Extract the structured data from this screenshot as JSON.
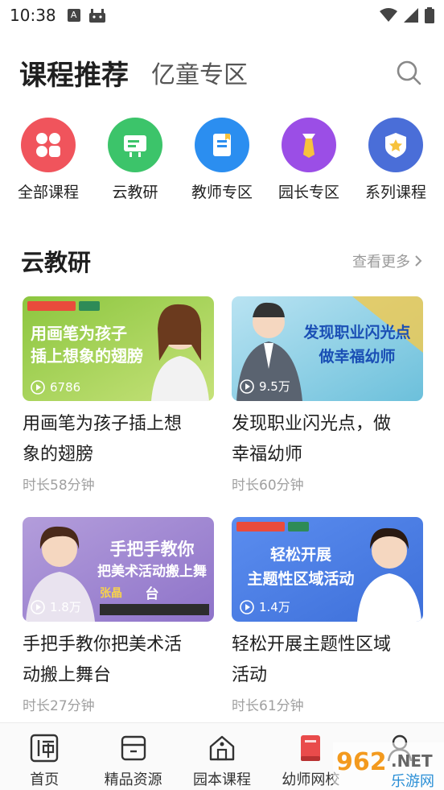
{
  "status_bar": {
    "time": "10:38",
    "left_icons": [
      "a-icon",
      "android-icon"
    ],
    "right_icons": [
      "wifi-icon",
      "signal-icon",
      "battery-icon"
    ]
  },
  "header": {
    "active_tab": "课程推荐",
    "inactive_tab": "亿童专区",
    "search_icon": "search-icon"
  },
  "categories": [
    {
      "label": "全部课程",
      "icon": "grid-icon",
      "color": "#f0545c"
    },
    {
      "label": "云教研",
      "icon": "board-icon",
      "color": "#3cc46a"
    },
    {
      "label": "教师专区",
      "icon": "document-icon",
      "color": "#2b8ef0"
    },
    {
      "label": "园长专区",
      "icon": "tie-icon",
      "color": "#9b4ee6"
    },
    {
      "label": "系列课程",
      "icon": "star-shield-icon",
      "color": "#4a6ed8"
    }
  ],
  "section": {
    "title": "云教研",
    "more": "查看更多"
  },
  "cards": [
    {
      "title_line1": "用画笔为孩子插上想",
      "title_line2": "象的翅膀",
      "duration": "时长58分钟",
      "views": "6786",
      "thumb_text1": "用画笔为孩子",
      "thumb_text2": "插上想象的翅膀"
    },
    {
      "title_line1": "发现职业闪光点，做",
      "title_line2": "幸福幼师",
      "duration": "时长60分钟",
      "views": "9.5万",
      "thumb_text1": "发现职业闪光点",
      "thumb_text2": "做幸福幼师"
    },
    {
      "title_line1": "手把手教你把美术活",
      "title_line2": "动搬上舞台",
      "duration": "时长27分钟",
      "views": "1.8万",
      "thumb_text1": "手把手教你",
      "thumb_text2": "把美术活动搬上舞台",
      "thumb_name": "张晶"
    },
    {
      "title_line1": "轻松开展主题性区域",
      "title_line2": "活动",
      "duration": "时长61分钟",
      "views": "1.4万",
      "thumb_text1": "轻松开展",
      "thumb_text2": "主题性区域活动"
    }
  ],
  "bottom_nav": [
    {
      "label": "首页",
      "icon": "shi-icon"
    },
    {
      "label": "精品资源",
      "icon": "box-icon"
    },
    {
      "label": "园本课程",
      "icon": "school-icon"
    },
    {
      "label": "幼师网校",
      "icon": "book-icon",
      "active": true
    },
    {
      "label": "",
      "icon": "user-icon"
    }
  ],
  "watermark": {
    "brand": "962",
    "suffix": ".NET",
    "sub": "乐游网"
  }
}
